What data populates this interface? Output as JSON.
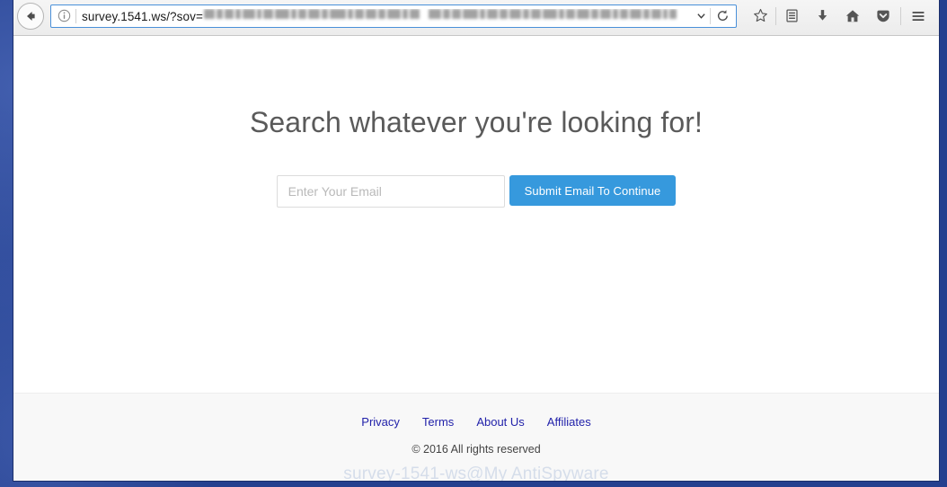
{
  "browser": {
    "back_button": "back-arrow-icon",
    "identity_icon": "info-circle-icon",
    "url_visible": "survey.1541.ws/?sov=",
    "url_redacted_note": "blurred query string",
    "url_dropdown": "chevron-down-icon",
    "reload": "reload-icon",
    "toolbar_icons": [
      {
        "name": "bookmark-star-icon",
        "label": "Bookmark this page"
      },
      {
        "name": "library-icon",
        "label": "Show your library"
      },
      {
        "name": "download-icon",
        "label": "Downloads"
      },
      {
        "name": "home-icon",
        "label": "Home"
      },
      {
        "name": "pocket-icon",
        "label": "Save to Pocket"
      },
      {
        "name": "hamburger-menu-icon",
        "label": "Open menu"
      }
    ]
  },
  "page": {
    "headline": "Search whatever you're looking for!",
    "form": {
      "email_placeholder": "Enter Your Email",
      "email_value": "",
      "submit_label": "Submit Email To Continue"
    },
    "footer": {
      "links": [
        {
          "label": "Privacy"
        },
        {
          "label": "Terms"
        },
        {
          "label": "About Us"
        },
        {
          "label": "Affiliates"
        }
      ],
      "copyright": "© 2016 All rights reserved",
      "watermark": "survey-1541-ws@My AntiSpyware"
    }
  },
  "colors": {
    "accent_blue": "#3699dd",
    "link_blue": "#2222aa",
    "headline_gray": "#5a5a5a",
    "footer_bg": "#f8f8f8",
    "desktop_blue": "#25408f"
  }
}
